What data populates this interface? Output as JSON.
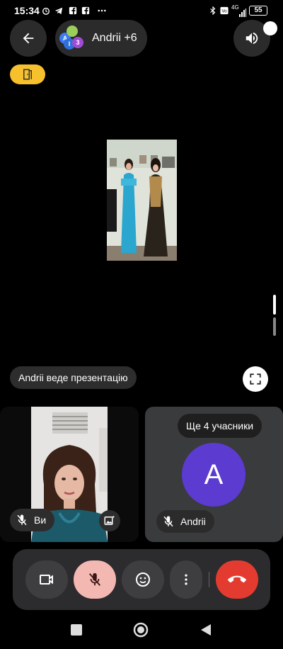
{
  "status_bar": {
    "time": "15:34",
    "battery": "55",
    "network": "4G"
  },
  "top_bar": {
    "chip_label": "Andrii +6",
    "avatar_letters": [
      "A",
      "I",
      "3"
    ]
  },
  "presentation": {
    "presenting_label": "Andrii веде презентацію"
  },
  "self_tile": {
    "name": "Ви"
  },
  "other_tile": {
    "more_label": "Ще 4 учасники",
    "avatar_letter": "A",
    "name": "Andrii"
  },
  "colors": {
    "end_call": "#e33b2f",
    "mic_muted_bg": "#f4b8b3",
    "exit_badge": "#f6c12c",
    "avatar": "#5c3bd1"
  }
}
